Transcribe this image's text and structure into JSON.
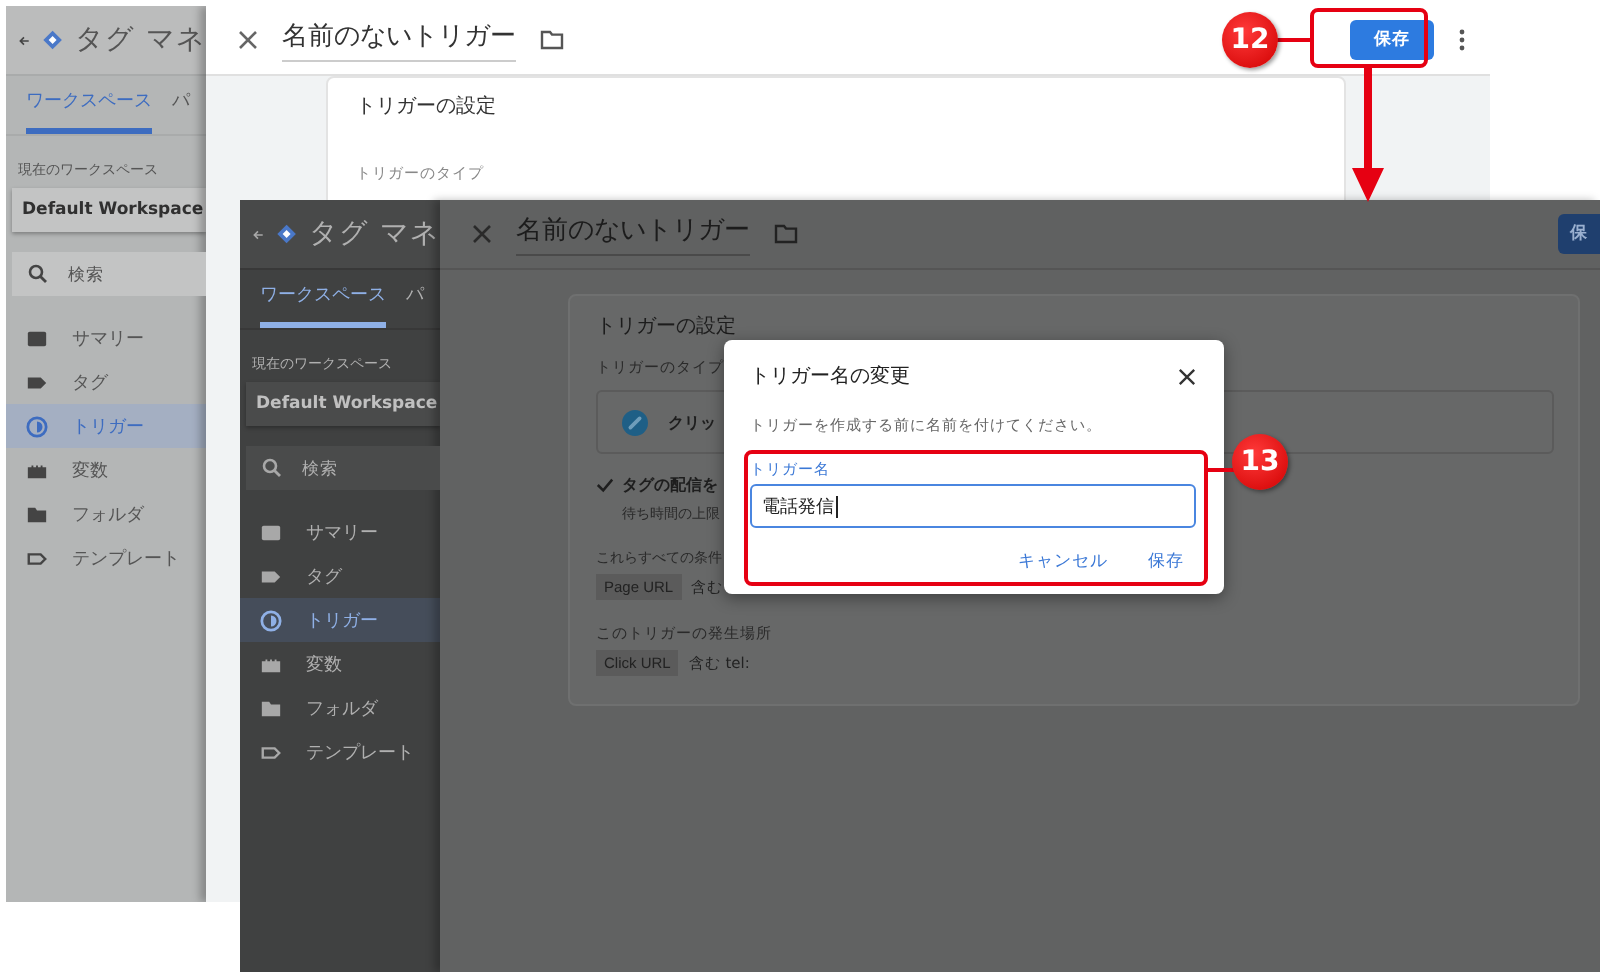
{
  "back_screen": {
    "sidebar": {
      "app_title": "タグ マネ",
      "tabs": [
        {
          "label": "ワークスペース",
          "selected": true
        },
        {
          "label": "パ",
          "selected": false
        }
      ],
      "workspace_label": "現在のワークスペース",
      "workspace": "Default Workspace",
      "search": {
        "placeholder": "検索"
      },
      "nav": [
        {
          "label": "サマリー",
          "kind": "summary",
          "selected": false
        },
        {
          "label": "タグ",
          "kind": "tag",
          "selected": false
        },
        {
          "label": "トリガー",
          "kind": "trigger",
          "selected": true
        },
        {
          "label": "変数",
          "kind": "variable",
          "selected": false
        },
        {
          "label": "フォルダ",
          "kind": "folder",
          "selected": false
        },
        {
          "label": "テンプレート",
          "kind": "template",
          "selected": false
        }
      ]
    },
    "panel": {
      "title": "名前のないトリガー",
      "save_button": "保存",
      "card_title": "トリガーの設定",
      "type_label": "トリガーのタイプ"
    }
  },
  "front_screen": {
    "sidebar": {
      "app_title": "タグ マネ",
      "tabs": [
        {
          "label": "ワークスペース",
          "selected": true
        },
        {
          "label": "パ",
          "selected": false
        }
      ],
      "workspace_label": "現在のワークスペース",
      "workspace": "Default Workspace",
      "search": {
        "placeholder": "検索"
      },
      "nav": [
        {
          "label": "サマリー",
          "kind": "summary",
          "selected": false
        },
        {
          "label": "タグ",
          "kind": "tag",
          "selected": false
        },
        {
          "label": "トリガー",
          "kind": "trigger",
          "selected": true
        },
        {
          "label": "変数",
          "kind": "variable",
          "selected": false
        },
        {
          "label": "フォルダ",
          "kind": "folder",
          "selected": false
        },
        {
          "label": "テンプレート",
          "kind": "template",
          "selected": false
        }
      ]
    },
    "panel": {
      "title": "名前のないトリガー",
      "save_button": "保",
      "card": {
        "title": "トリガーの設定",
        "type_label": "トリガーのタイプ",
        "type_name": "クリッ",
        "wait_option": {
          "label": "タグの配信を",
          "checked": true,
          "note": "待ち時間の上限"
        },
        "conditions_label": "これらすべての条件",
        "conditions": [
          {
            "variable": "Page URL",
            "operator": "含む"
          }
        ],
        "fires_on_label": "このトリガーの発生場所",
        "fires_on": [
          {
            "variable": "Click URL",
            "operator": "含む",
            "value": "tel:"
          }
        ]
      }
    },
    "dialog": {
      "title": "トリガー名の変更",
      "description": "トリガーを作成する前に名前を付けてください。",
      "field": {
        "label": "トリガー名",
        "value": "電話発信"
      },
      "buttons": [
        {
          "label": "キャンセル"
        },
        {
          "label": "保存"
        }
      ]
    }
  },
  "annotations": [
    {
      "number": "12"
    },
    {
      "number": "13"
    }
  ]
}
